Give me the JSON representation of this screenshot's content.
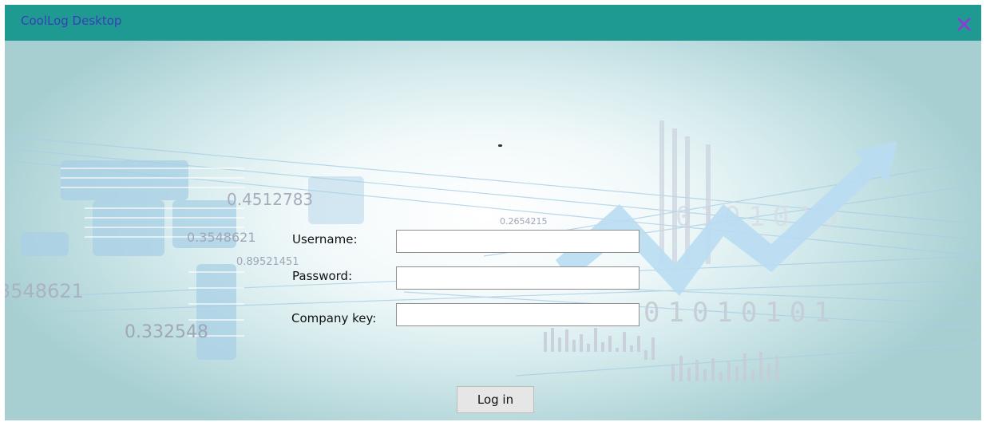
{
  "window": {
    "title": "CoolLog Desktop",
    "close_icon": "close-icon",
    "titlebar_color": "#1e9a93",
    "title_color": "#3b3db8",
    "close_color": "#8a3fd1"
  },
  "background": {
    "numbers": [
      "0.4512783",
      "0.3548621",
      "0.89521451",
      "3548621",
      "0.332548",
      "0.2654215"
    ],
    "binary_row": "01010101",
    "binary_top": "0101010"
  },
  "form": {
    "username_label": "Username:",
    "username_value": "",
    "password_label": "Password:",
    "password_value": "",
    "company_label": "Company key:",
    "company_value": "",
    "login_label": "Log in"
  }
}
